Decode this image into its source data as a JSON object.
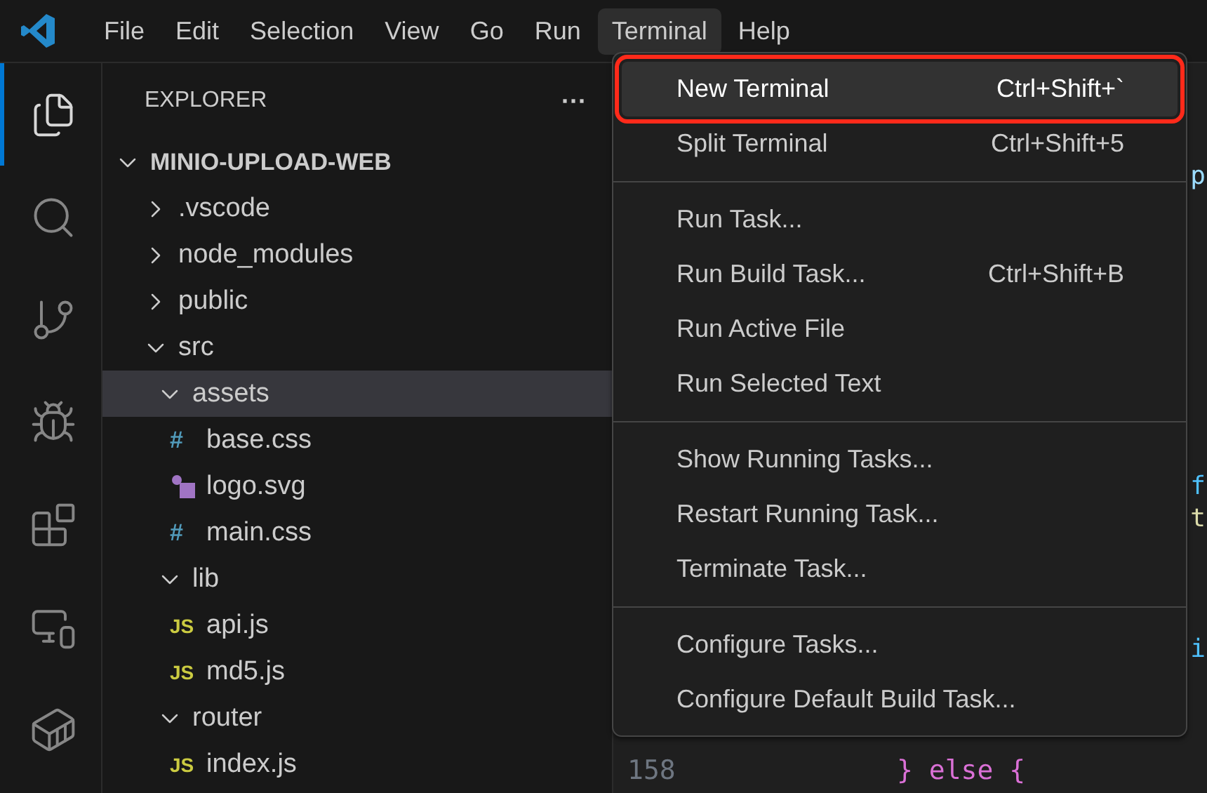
{
  "menubar": [
    {
      "label": "File",
      "selected": false
    },
    {
      "label": "Edit",
      "selected": false
    },
    {
      "label": "Selection",
      "selected": false
    },
    {
      "label": "View",
      "selected": false
    },
    {
      "label": "Go",
      "selected": false
    },
    {
      "label": "Run",
      "selected": false
    },
    {
      "label": "Terminal",
      "selected": true
    },
    {
      "label": "Help",
      "selected": false
    }
  ],
  "activity_bar": [
    {
      "kind": "explorer",
      "selected": true
    },
    {
      "kind": "search",
      "selected": false
    },
    {
      "kind": "source-control",
      "selected": false
    },
    {
      "kind": "run-debug",
      "selected": false
    },
    {
      "kind": "extensions",
      "selected": false
    },
    {
      "kind": "remote",
      "selected": false
    },
    {
      "kind": "docker",
      "selected": false
    }
  ],
  "sidebar": {
    "title": "EXPLORER",
    "more": "···",
    "tree": {
      "label": "MINIO-UPLOAD-WEB",
      "kind": "root",
      "expanded": true,
      "selected": false,
      "children": [
        {
          "label": ".vscode",
          "kind": "folder",
          "expanded": false,
          "selected": false
        },
        {
          "label": "node_modules",
          "kind": "folder",
          "expanded": false,
          "selected": false
        },
        {
          "label": "public",
          "kind": "folder",
          "expanded": false,
          "selected": false
        },
        {
          "label": "src",
          "kind": "folder",
          "expanded": true,
          "selected": false,
          "children": [
            {
              "label": "assets",
              "kind": "folder",
              "expanded": true,
              "selected": true,
              "children": [
                {
                  "label": "base.css",
                  "kind": "css",
                  "icon": "#",
                  "selected": false
                },
                {
                  "label": "logo.svg",
                  "kind": "svg",
                  "selected": false
                },
                {
                  "label": "main.css",
                  "kind": "css",
                  "icon": "#",
                  "selected": false
                }
              ]
            },
            {
              "label": "lib",
              "kind": "folder",
              "expanded": true,
              "selected": false,
              "children": [
                {
                  "label": "api.js",
                  "kind": "js",
                  "icon": "JS",
                  "selected": false
                },
                {
                  "label": "md5.js",
                  "kind": "js",
                  "icon": "JS",
                  "selected": false
                }
              ]
            },
            {
              "label": "router",
              "kind": "folder",
              "expanded": true,
              "selected": false,
              "children": [
                {
                  "label": "index.js",
                  "kind": "js",
                  "icon": "JS",
                  "selected": false
                }
              ]
            }
          ]
        }
      ]
    }
  },
  "editor": {
    "lines": [
      {
        "code": "p",
        "color": "#9cdcfe"
      },
      {
        "code": "f",
        "color": "#4fc1ff"
      },
      {
        "code": "t",
        "color": "#dcdcaa"
      },
      {
        "code": "i",
        "color": "#4fc1ff"
      }
    ],
    "last_line": {
      "number": "158",
      "code": "} else {"
    }
  },
  "terminal_menu": {
    "groups": [
      [
        {
          "label": "New Terminal",
          "shortcut": "Ctrl+Shift+`",
          "selected": true
        },
        {
          "label": "Split Terminal",
          "shortcut": "Ctrl+Shift+5",
          "selected": false
        }
      ],
      [
        {
          "label": "Run Task...",
          "selected": false
        },
        {
          "label": "Run Build Task...",
          "shortcut": "Ctrl+Shift+B",
          "selected": false
        },
        {
          "label": "Run Active File",
          "selected": false
        },
        {
          "label": "Run Selected Text",
          "selected": false
        }
      ],
      [
        {
          "label": "Show Running Tasks...",
          "selected": false
        },
        {
          "label": "Restart Running Task...",
          "selected": false
        },
        {
          "label": "Terminate Task...",
          "selected": false
        }
      ],
      [
        {
          "label": "Configure Tasks...",
          "selected": false
        },
        {
          "label": "Configure Default Build Task...",
          "selected": false
        }
      ]
    ]
  }
}
